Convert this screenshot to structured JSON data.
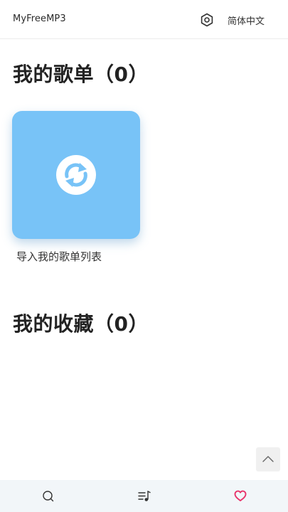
{
  "header": {
    "app_title": "MyFreeMP3",
    "settings_icon": "settings-hexagon-icon",
    "language_label": "简体中文"
  },
  "playlists": {
    "title": "我的歌单（0）",
    "import_card": {
      "icon": "refresh-icon",
      "color": "#78c3f7",
      "label": "导入我的歌单列表"
    }
  },
  "favorites": {
    "title": "我的收藏（0）"
  },
  "scroll_top": {
    "icon": "chevron-up-icon"
  },
  "bottom_nav": {
    "items": [
      {
        "icon": "search-icon",
        "active": false
      },
      {
        "icon": "playlist-icon",
        "active": false
      },
      {
        "icon": "heart-icon",
        "active": true,
        "color": "#e8336a"
      }
    ]
  }
}
